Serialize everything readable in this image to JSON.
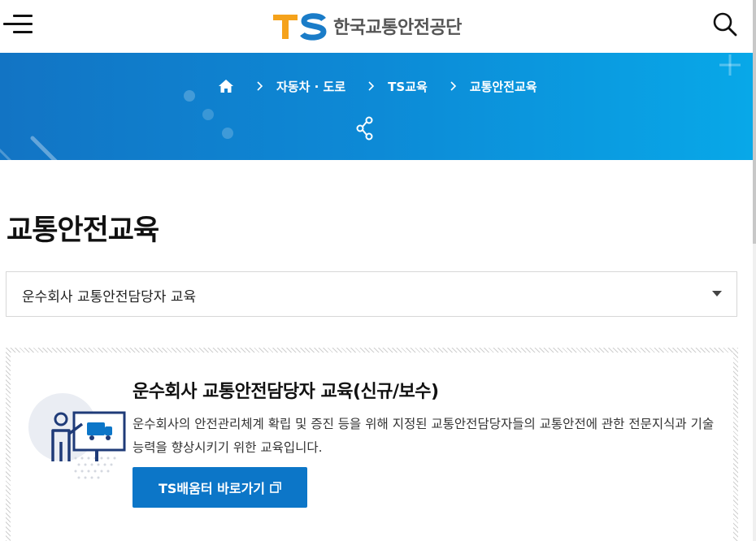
{
  "header": {
    "logo_mark": "TS",
    "logo_text": "한국교통안전공단",
    "menu_icon": "hamburger-menu-icon",
    "search_icon": "search-icon"
  },
  "banner": {
    "breadcrumb": [
      {
        "label": "자동차 · 도로"
      },
      {
        "label": "TS교육"
      },
      {
        "label": "교통안전교육"
      }
    ],
    "share_icon": "share-icon"
  },
  "page": {
    "title": "교통안전교육"
  },
  "course_select": {
    "selected": "운수회사 교통안전담당자 교육"
  },
  "card": {
    "title": "운수회사 교통안전담당자 교육(신규/보수)",
    "description": "운수회사의 안전관리체계 확립 및 증진 등을 위해 지정된 교통안전담당자들의 교통안전에 관한 전문지식과 기술능력을 향상시키기 위한 교육입니다.",
    "button_label": "TS배움터 바로가기",
    "button_icon": "external-link-icon"
  },
  "colors": {
    "brand_blue": "#0c76c8",
    "banner_start": "#1274c4",
    "banner_end": "#08a8e8",
    "logo_orange": "#f5a21b"
  }
}
